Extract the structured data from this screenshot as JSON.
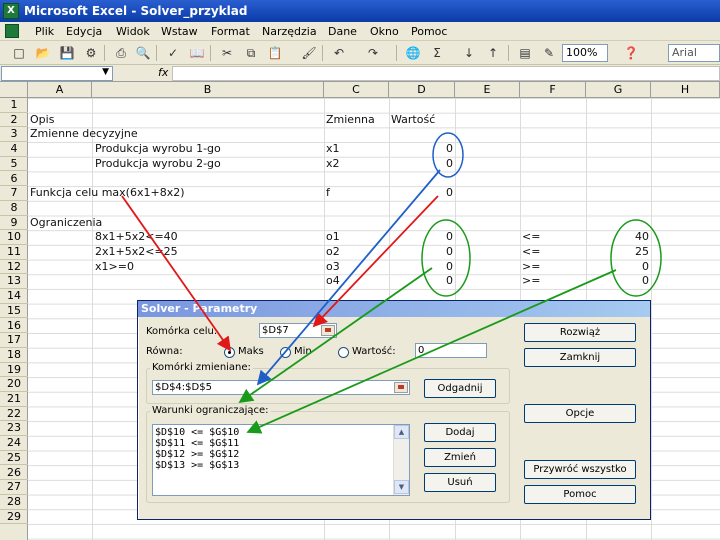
{
  "window": {
    "title": "Microsoft Excel - Solver_przyklad"
  },
  "menu": {
    "items": [
      "Plik",
      "Edycja",
      "Widok",
      "Wstaw",
      "Format",
      "Narzędzia",
      "Dane",
      "Okno",
      "Pomoc"
    ]
  },
  "toolbar": {
    "zoom": "100%",
    "font": "Arial"
  },
  "formula": {
    "fx": "fx"
  },
  "grid": {
    "columns": [
      "A",
      "B",
      "C",
      "D",
      "E",
      "F",
      "G",
      "H"
    ],
    "rows": [
      "1",
      "2",
      "3",
      "4",
      "5",
      "6",
      "7",
      "8",
      "9",
      "10",
      "11",
      "12",
      "13",
      "14",
      "15",
      "16",
      "17",
      "18",
      "19",
      "20",
      "21",
      "22",
      "23",
      "24",
      "25",
      "26",
      "27",
      "28",
      "29"
    ],
    "cells": {
      "a2": "Opis",
      "c2": "Zmienna",
      "d2": "Wartość",
      "a3": "Zmienne decyzyjne",
      "b4": "Produkcja wyrobu 1-go",
      "c4": "x1",
      "d4": "0",
      "b5": "Produkcja wyrobu 2-go",
      "c5": "x2",
      "d5": "0",
      "a7": "Funkcja celu max(6x1+8x2)",
      "c7": "f",
      "d7": "0",
      "a9": "Ograniczenia",
      "b10": "8x1+5x2<=40",
      "c10": "o1",
      "d10": "0",
      "f10": "<=",
      "g10": "40",
      "b11": "2x1+5x2<=25",
      "c11": "o2",
      "d11": "0",
      "f11": "<=",
      "g11": "25",
      "b12": "x1>=0",
      "c12": "o3",
      "d12": "0",
      "f12": ">=",
      "g12": "0",
      "c13": "o4",
      "d13": "0",
      "f13": ">=",
      "g13": "0"
    }
  },
  "dialog": {
    "title": "Solver - Parametry",
    "target_label": "Komórka celu:",
    "target_value": "$D$7",
    "equal_label": "Równa:",
    "opt_max": "Maks",
    "opt_min": "Min",
    "opt_value": "Wartość:",
    "value_field": "0",
    "changing_label": "Komórki zmieniane:",
    "changing_value": "$D$4:$D$5",
    "constraints_label": "Warunki ograniczające:",
    "constraints": [
      "$D$10 <= $G$10",
      "$D$11 <= $G$11",
      "$D$12 >= $G$12",
      "$D$13 >= $G$13"
    ],
    "buttons": {
      "solve": "Rozwiąż",
      "close": "Zamknij",
      "guess": "Odgadnij",
      "options": "Opcje",
      "add": "Dodaj",
      "change": "Zmień",
      "delete": "Usuń",
      "reset": "Przywróć wszystko",
      "help": "Pomoc"
    }
  },
  "annotation_colors": {
    "red": "#e01818",
    "blue": "#1f5fc8",
    "green": "#1a9a1a"
  }
}
